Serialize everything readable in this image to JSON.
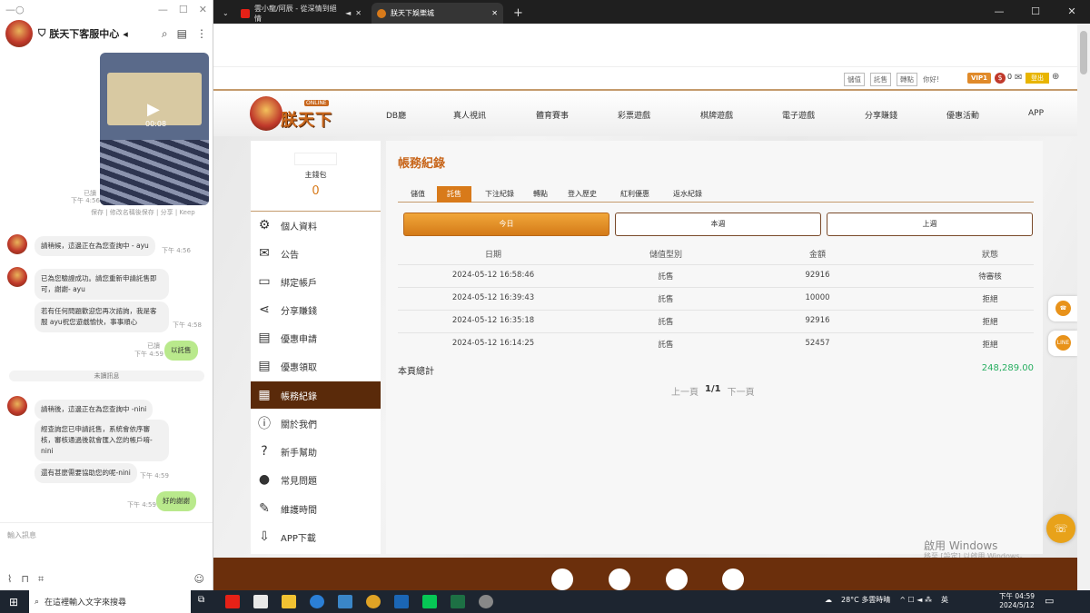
{
  "chat": {
    "title": "朕天下客服中心",
    "video_duration": "00:08",
    "video_read": "已讀",
    "video_time": "下午 4:56",
    "video_actions": "保存 | 修改名稱後保存 | 分享 | Keep",
    "messages": [
      {
        "text": "請稍候，這邊正在為您查詢中 - ayu",
        "time": "下午 4:56"
      },
      {
        "text": "已為您驗證成功。請您重新申請託售即可，謝謝- ayu",
        "time": ""
      },
      {
        "text": "若有任何問題歡迎您再次諮詢，我是客服 ayu祝您遊戲愉快，事事順心",
        "time": "下午 4:58"
      },
      {
        "text": "以託售",
        "time": "下午 4:59",
        "read": "已讀"
      },
      {
        "text": "請稍後，這邊正在為您查詢中 -nini",
        "time": ""
      },
      {
        "text": "經查詢您已申請託售，系統會依序審核，審核通過後就會匯入您的帳戶唷-nini",
        "time": ""
      },
      {
        "text": "還有甚麼需要協助您的呢-nini",
        "time": "下午 4:59"
      },
      {
        "text": "好的謝謝",
        "time": "下午 4:59"
      }
    ],
    "unread_sep": "未讀訊息",
    "input_placeholder": "輸入訊息"
  },
  "browser": {
    "tabs": [
      {
        "title": "雲小龍/阿辰 - 從深情到絕情"
      },
      {
        "title": "朕天下娛樂城"
      }
    ],
    "new_tab": "+"
  },
  "site": {
    "util_links": [
      "儲值",
      "託售",
      "轉點",
      "你好!"
    ],
    "vip": "VIP1",
    "coin_value": "0",
    "login": "登出",
    "nav": [
      "DB廳",
      "真人視訊",
      "體育賽事",
      "彩票遊戲",
      "棋牌遊戲",
      "電子遊戲",
      "分享賺錢",
      "優惠活動",
      "APP"
    ],
    "logo_text": "朕天下",
    "logo_online": "ONLINE",
    "sidebar": {
      "wallet_label": "主錢包",
      "wallet_value": "0",
      "items": [
        {
          "label": "個人資料",
          "icon": "gear-icon"
        },
        {
          "label": "公告",
          "icon": "mail-icon"
        },
        {
          "label": "綁定帳戶",
          "icon": "card-icon"
        },
        {
          "label": "分享賺錢",
          "icon": "share-icon"
        },
        {
          "label": "優惠申請",
          "icon": "document-icon"
        },
        {
          "label": "優惠領取",
          "icon": "document-icon"
        },
        {
          "label": "帳務紀錄",
          "icon": "clipboard-icon"
        },
        {
          "label": "關於我們",
          "icon": "info-icon"
        },
        {
          "label": "新手幫助",
          "icon": "question-icon"
        },
        {
          "label": "常見問題",
          "icon": "chat-icon"
        },
        {
          "label": "維護時間",
          "icon": "wrench-icon"
        },
        {
          "label": "APP下載",
          "icon": "download-icon"
        }
      ]
    },
    "content": {
      "title": "帳務紀錄",
      "subtabs": [
        "儲值",
        "託售",
        "下注紀錄",
        "轉點",
        "登入歷史",
        "紅利優惠",
        "返水紀錄"
      ],
      "ranges": [
        "今日",
        "本週",
        "上週"
      ],
      "columns": [
        "日期",
        "儲值型別",
        "金額",
        "狀態"
      ],
      "rows": [
        [
          "2024-05-12 16:58:46",
          "託售",
          "92916",
          "待審核"
        ],
        [
          "2024-05-12 16:39:43",
          "託售",
          "10000",
          "拒絕"
        ],
        [
          "2024-05-12 16:35:18",
          "託售",
          "92916",
          "拒絕"
        ],
        [
          "2024-05-12 16:14:25",
          "託售",
          "52457",
          "拒絕"
        ]
      ],
      "total_label": "本頁總計",
      "total_value": "248,289.00",
      "pager_prev": "上一頁",
      "pager_current": "1/1",
      "pager_next": "下一頁"
    },
    "float_line": "LINE",
    "watermark": "啟用 Windows",
    "watermark_sub": "移至 [設定] 以啟用 Windows。"
  },
  "taskbar": {
    "search_placeholder": "在這裡輸入文字來搜尋",
    "weather": "28°C 多雲時晴",
    "ime": "英",
    "time": "下午 04:59",
    "date": "2024/5/12"
  },
  "colors": {
    "accent": "#d87a1a",
    "sidebar_active": "#5a2a0a",
    "footer": "#6b2f0c",
    "total": "#27ae60"
  }
}
